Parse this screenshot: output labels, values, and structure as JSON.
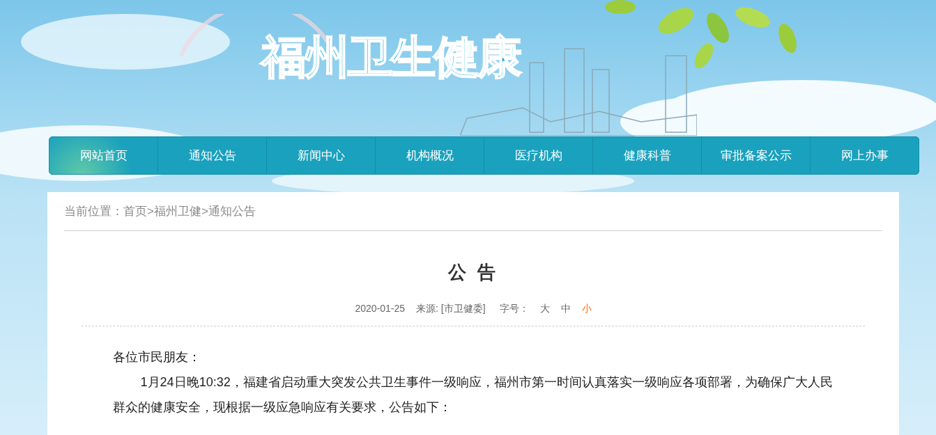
{
  "site": {
    "logo": "福州卫生健康"
  },
  "nav": [
    {
      "label": "网站首页",
      "selected": true
    },
    {
      "label": "通知公告",
      "selected": false
    },
    {
      "label": "新闻中心",
      "selected": false
    },
    {
      "label": "机构概况",
      "selected": false
    },
    {
      "label": "医疗机构",
      "selected": false
    },
    {
      "label": "健康科普",
      "selected": false
    },
    {
      "label": "审批备案公示",
      "selected": false
    },
    {
      "label": "网上办事",
      "selected": false
    }
  ],
  "breadcrumb": {
    "label": "当前位置：",
    "separator": ">",
    "items": [
      "首页",
      "福州卫健",
      "通知公告"
    ]
  },
  "article": {
    "title": "公 告",
    "date": "2020-01-25",
    "source": "来源: [市卫健委]",
    "font_size_label": "字号：",
    "font_sizes": [
      {
        "label": "大",
        "selected": false
      },
      {
        "label": "中",
        "selected": false
      },
      {
        "label": "小",
        "selected": true
      }
    ],
    "greeting": "各位市民朋友：",
    "paragraphs": [
      "1月24日晚10:32，福建省启动重大突发公共卫生事件一级响应，福州市第一时间认真落实一级响应各项部署，为确保广大人民群众的健康安全，现根据一级应急响应有关要求，公告如下："
    ]
  }
}
